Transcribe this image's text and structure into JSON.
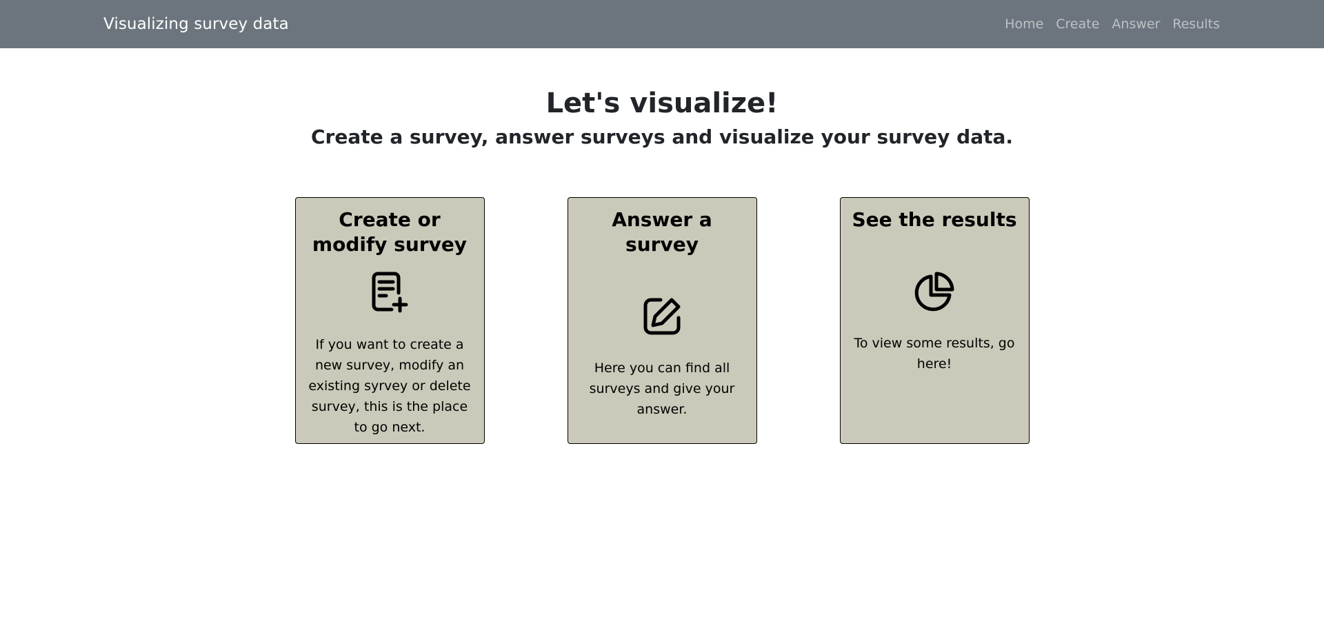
{
  "navbar": {
    "brand": "Visualizing survey data",
    "links": [
      "Home",
      "Create",
      "Answer",
      "Results"
    ]
  },
  "hero": {
    "title": "Let's visualize!",
    "subtitle": "Create a survey, answer surveys and visualize your survey data."
  },
  "cards": [
    {
      "title": "Create or modify survey",
      "icon": "document-plus-icon",
      "text": "If you want to create a new survey, modify an existing syrvey or delete survey, this is the place to go next."
    },
    {
      "title": "Answer a survey",
      "icon": "pencil-square-icon",
      "text": "Here you can find all surveys and give your answer."
    },
    {
      "title": "See the results",
      "icon": "pie-chart-icon",
      "text": "To view some results, go here!"
    }
  ],
  "colors": {
    "navbar": "#6c757d",
    "card_background": "#cbc9b9"
  }
}
